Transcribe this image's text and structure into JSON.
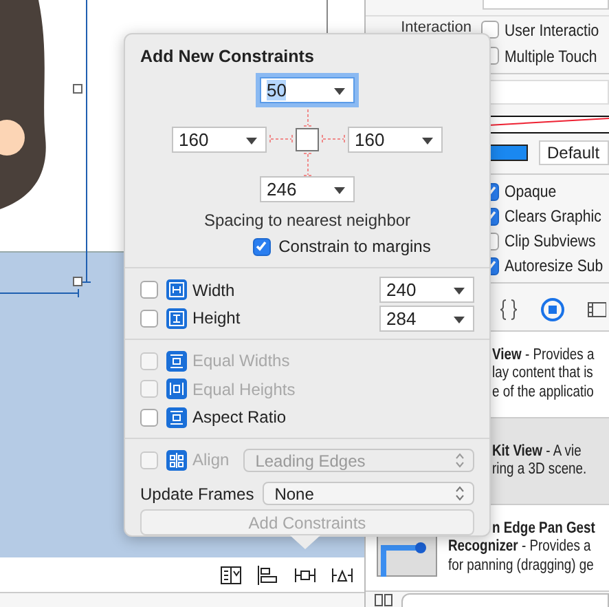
{
  "popover": {
    "title": "Add New Constraints",
    "spacing": {
      "top": {
        "value": "50",
        "selected": true
      },
      "left": {
        "value": "160",
        "selected": false
      },
      "right": {
        "value": "160",
        "selected": false
      },
      "bottom": {
        "value": "246",
        "selected": false
      }
    },
    "caption": "Spacing to nearest neighbor",
    "constrain_to_margins": {
      "label": "Constrain to margins",
      "checked": true
    },
    "sizes": [
      {
        "kind": "width",
        "label": "Width",
        "checked": false,
        "value": "240"
      },
      {
        "kind": "height",
        "label": "Height",
        "checked": false,
        "value": "284"
      }
    ],
    "relations": [
      {
        "kind": "equal-widths",
        "label": "Equal Widths",
        "checked": false,
        "disabled": true
      },
      {
        "kind": "equal-heights",
        "label": "Equal Heights",
        "checked": false,
        "disabled": true
      },
      {
        "kind": "aspect",
        "label": "Aspect Ratio",
        "checked": false,
        "disabled": false
      }
    ],
    "align": {
      "label": "Align",
      "checked": false,
      "disabled": true,
      "value": "Leading Edges"
    },
    "update_frames": {
      "label": "Update Frames",
      "value": "None"
    },
    "add_button": {
      "label": "Add Constraints",
      "disabled": true
    }
  },
  "inspector": {
    "interaction_label": "Interaction",
    "interaction_options": [
      {
        "label": "User Interactio",
        "checked": false
      },
      {
        "label": "Multiple Touch",
        "checked": false
      }
    ],
    "tint": "Default",
    "drawing_options": [
      {
        "label": "Opaque",
        "checked": true
      },
      {
        "label": "Clears Graphic",
        "checked": true
      },
      {
        "label": "Clip Subviews",
        "checked": false
      },
      {
        "label": "Autoresize Sub",
        "checked": true
      }
    ],
    "library_tabs": [
      {
        "kind": "code",
        "selected": false
      },
      {
        "kind": "object",
        "selected": true
      },
      {
        "kind": "media",
        "selected": false
      }
    ],
    "library_items": [
      {
        "selected": false,
        "lines": [
          {
            "kind": "covered",
            "text": "**View** - Provides a"
          },
          {
            "kind": "covered",
            "text": "lay content that is"
          },
          {
            "kind": "covered",
            "text": "e of the applicatio"
          }
        ]
      },
      {
        "selected": true,
        "lines": [
          {
            "kind": "covered",
            "text": "**Kit View** - A vie"
          },
          {
            "kind": "covered",
            "text": "ring a 3D scene."
          }
        ]
      },
      {
        "selected": false,
        "icon_shown": true,
        "lines": [
          {
            "kind": "covered-heading",
            "text": "n Edge Pan Gest"
          },
          {
            "kind": "plain",
            "text": "**Recognizer** - Provides a"
          },
          {
            "kind": "plain",
            "text": "for panning (dragging) ge"
          }
        ]
      }
    ]
  }
}
